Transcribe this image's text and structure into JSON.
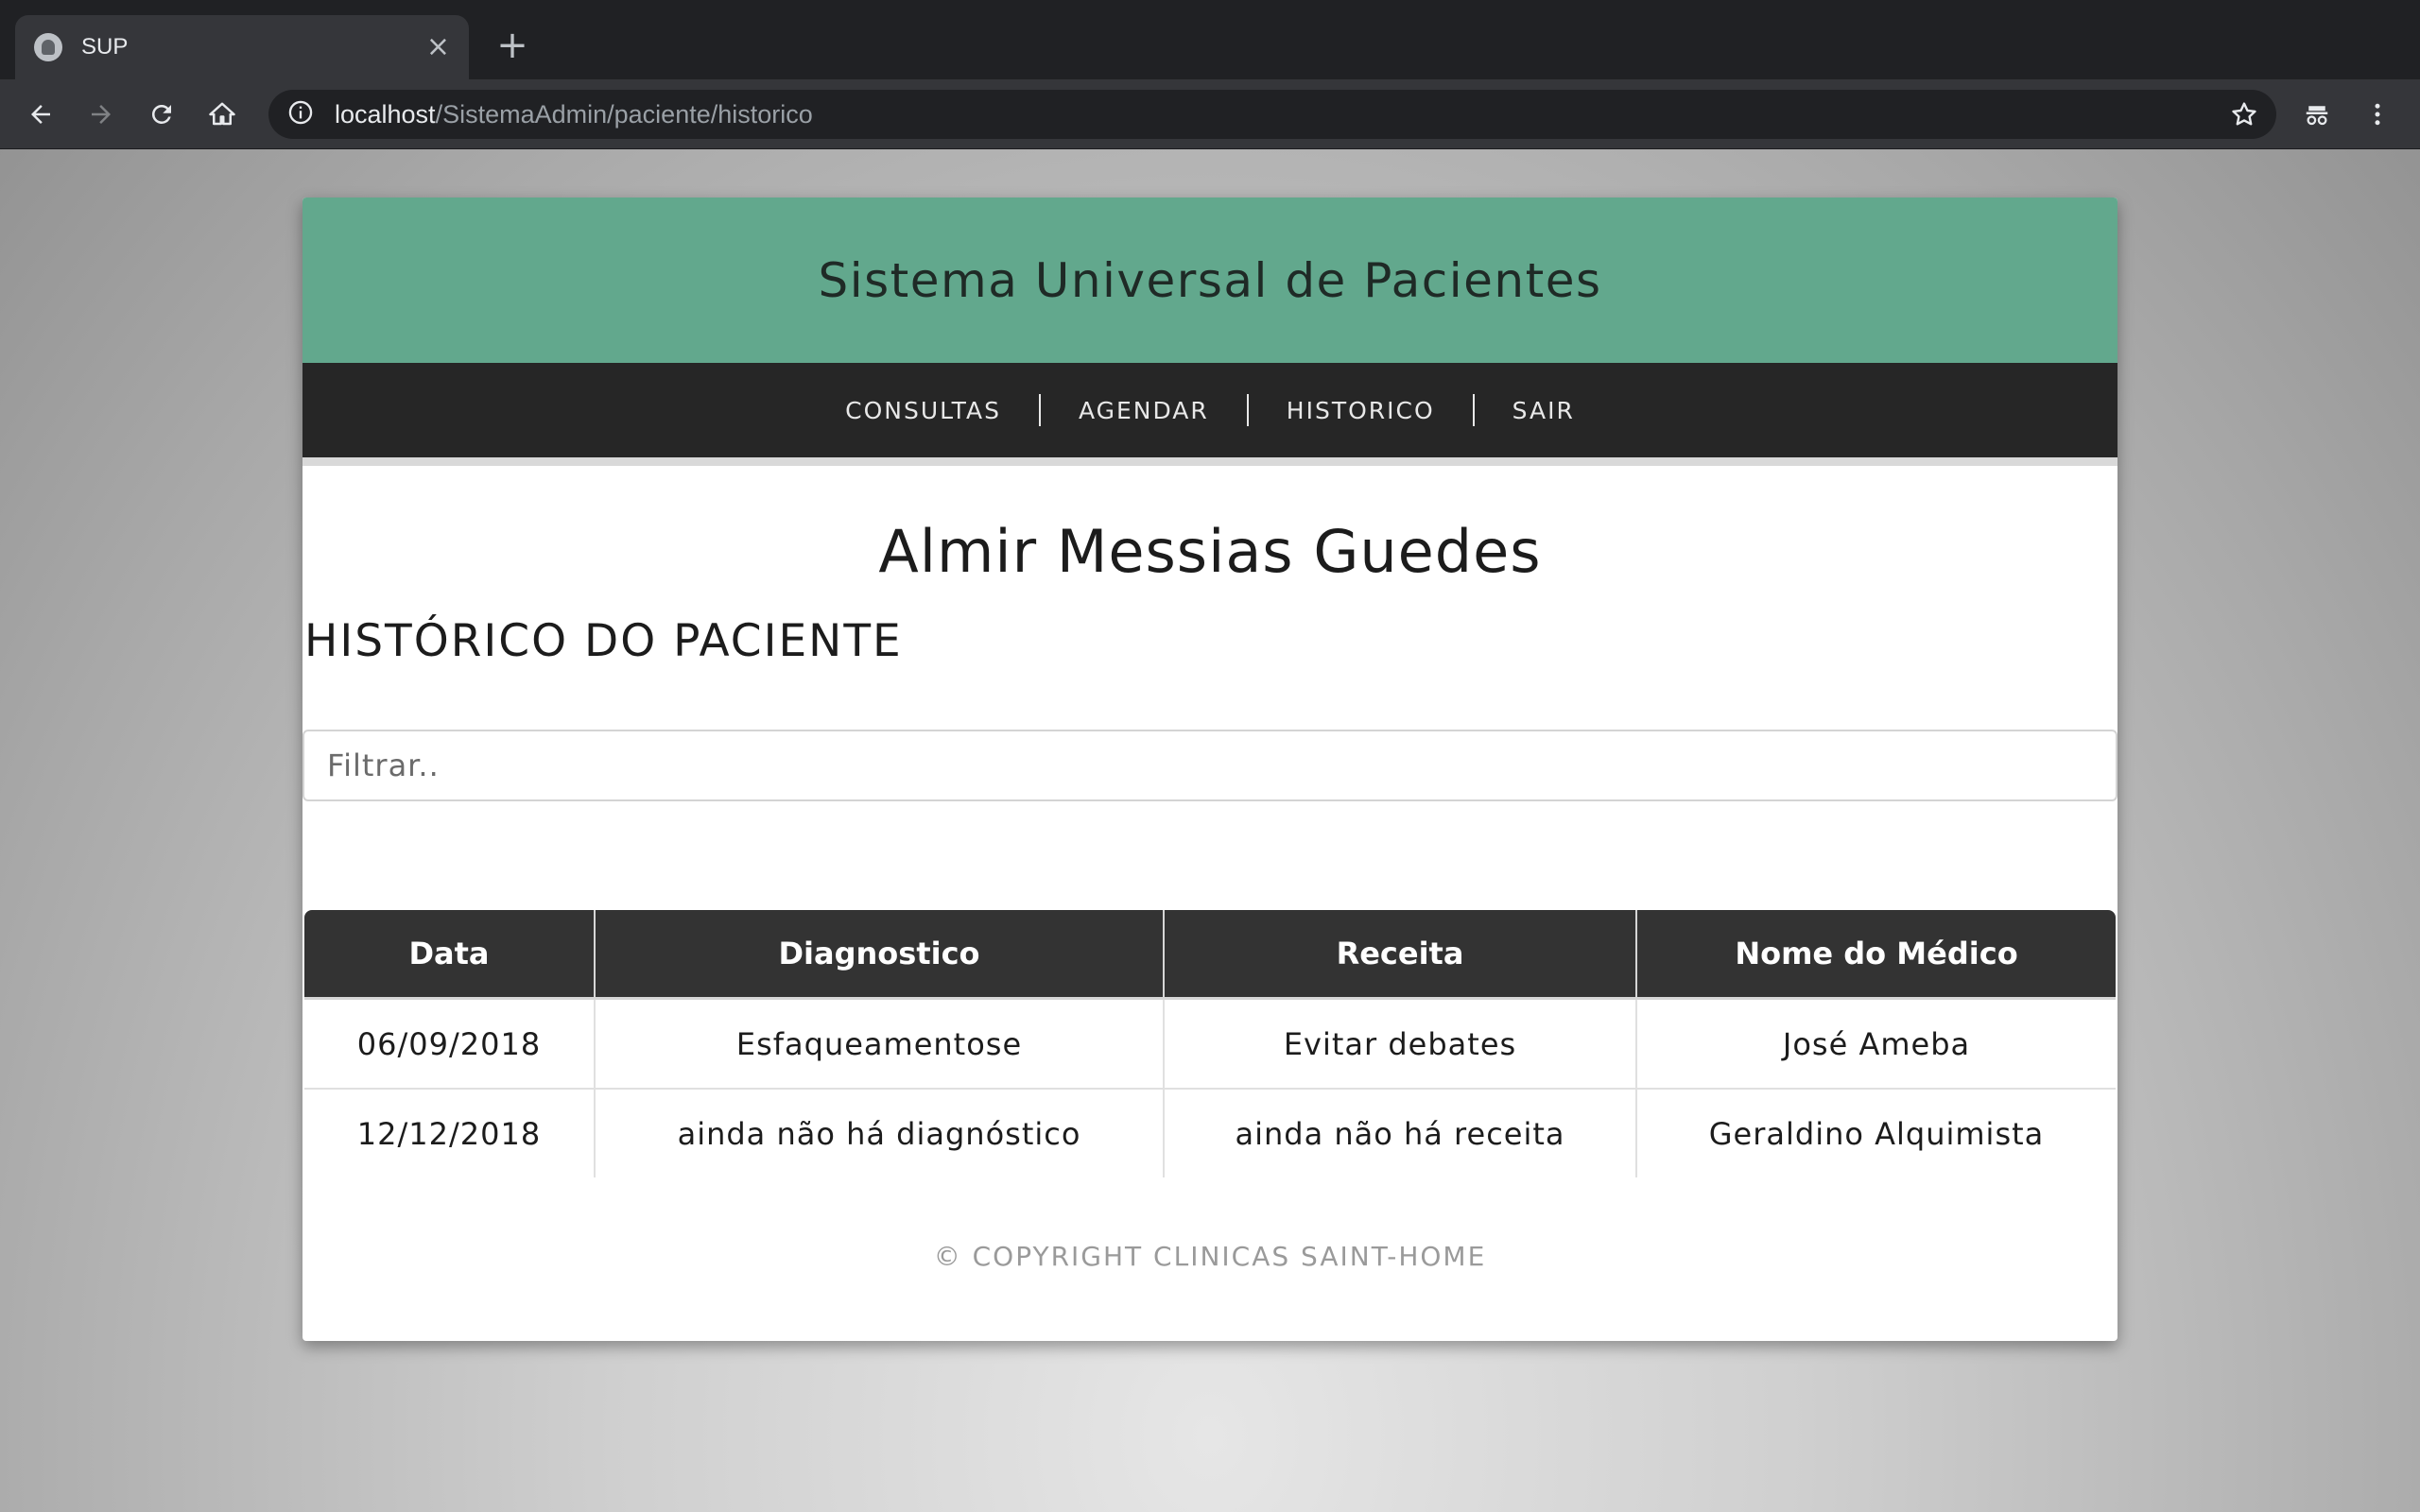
{
  "browser": {
    "tab_title": "SUP",
    "url_host": "localhost",
    "url_path": "/SistemaAdmin/paciente/historico"
  },
  "site": {
    "title": "Sistema Universal de Pacientes",
    "header_color": "#62a88d"
  },
  "nav": {
    "items": [
      "CONSULTAS",
      "AGENDAR",
      "HISTORICO",
      "SAIR"
    ]
  },
  "patient": {
    "name": "Almir Messias Guedes"
  },
  "section": {
    "title": "HISTÓRICO DO PACIENTE"
  },
  "filter": {
    "placeholder": "Filtrar.."
  },
  "table": {
    "headers": [
      "Data",
      "Diagnostico",
      "Receita",
      "Nome do Médico"
    ],
    "rows": [
      [
        "06/09/2018",
        "Esfaqueamentose",
        "Evitar debates",
        "José Ameba"
      ],
      [
        "12/12/2018",
        "ainda não há diagnóstico",
        "ainda não há receita",
        "Geraldino Alquimista"
      ]
    ]
  },
  "footer": {
    "text": "© COPYRIGHT CLINICAS SAINT-HOME"
  }
}
